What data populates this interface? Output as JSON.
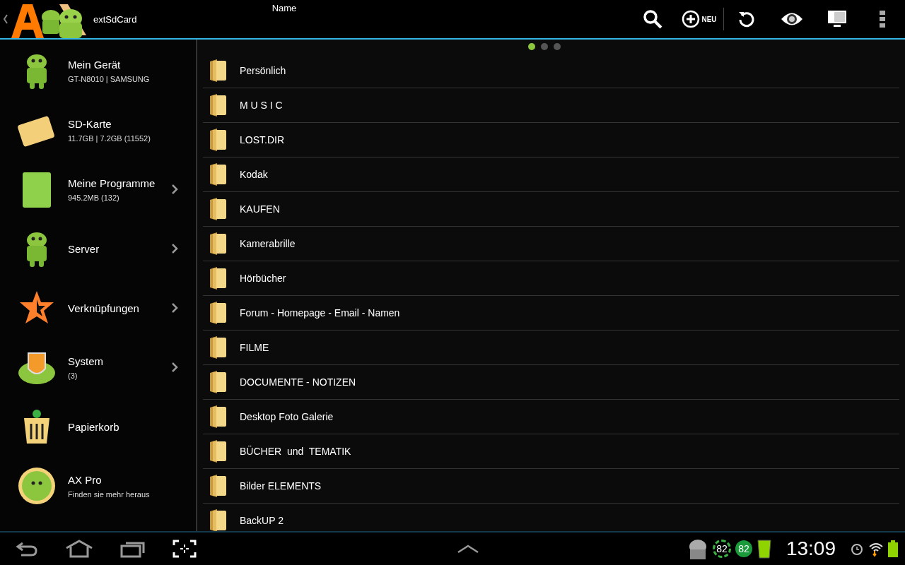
{
  "action_bar": {
    "path": "extSdCard",
    "sort_label": "Name",
    "new_label": "NEU"
  },
  "pager": [
    {
      "selected": true
    },
    {
      "selected": false
    },
    {
      "selected": false
    }
  ],
  "sidebar": {
    "items": [
      {
        "title": "Mein Gerät",
        "subtitle": "GT-N8010 | SAMSUNG",
        "submenu": false
      },
      {
        "title": "SD-Karte",
        "subtitle": "11.7GB | 7.2GB (11552)",
        "submenu": false
      },
      {
        "title": "Meine Programme",
        "subtitle": "945.2MB (132)",
        "submenu": true
      },
      {
        "title": "Server",
        "submenu": true
      },
      {
        "title": "Verknüpfungen",
        "submenu": true
      },
      {
        "title": "System",
        "subtitle": "(3)",
        "submenu": true
      },
      {
        "title": "Papierkorb",
        "submenu": false
      },
      {
        "title": "AX Pro",
        "subtitle": "Finden sie mehr heraus",
        "submenu": false
      }
    ]
  },
  "files": [
    {
      "name": "Persönlich"
    },
    {
      "name": "M U S I C"
    },
    {
      "name": "LOST.DIR"
    },
    {
      "name": "Kodak"
    },
    {
      "name": "KAUFEN"
    },
    {
      "name": "Kamerabrille"
    },
    {
      "name": "Hörbücher"
    },
    {
      "name": "Forum - Homepage - Email - Namen"
    },
    {
      "name": "FILME"
    },
    {
      "name": "DOCUMENTE - NOTIZEN"
    },
    {
      "name": "Desktop Foto Galerie"
    },
    {
      "name": "BÜCHER  und  TEMATIK"
    },
    {
      "name": "Bilder ELEMENTS"
    },
    {
      "name": "BackUP 2"
    }
  ],
  "status_bar": {
    "notifications": [
      "82",
      "82"
    ],
    "time": "13:09"
  }
}
